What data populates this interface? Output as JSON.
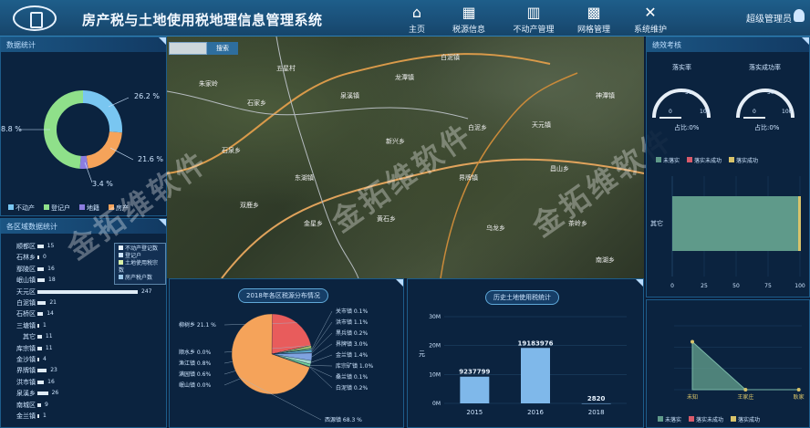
{
  "header": {
    "title": "房产税与土地使用税地理信息管理系统",
    "nav": [
      {
        "label": "主页",
        "icon": "home-icon"
      },
      {
        "label": "税源信息",
        "icon": "database-icon"
      },
      {
        "label": "不动产管理",
        "icon": "bar-chart-icon"
      },
      {
        "label": "网格管理",
        "icon": "map-icon"
      },
      {
        "label": "系统维护",
        "icon": "tools-icon"
      }
    ],
    "user": "超级管理员"
  },
  "data_stats": {
    "title": "数据统计",
    "pct_a": "26.2 %",
    "pct_b": "8.8 %",
    "pct_c": "21.6 %",
    "pct_d": "3.4 %",
    "legend": [
      "不动产",
      "登记户",
      "地籍",
      "房产"
    ]
  },
  "region_stats": {
    "title": "各区域数据统计",
    "legend": [
      "不动产登记数",
      "登记户",
      "土地使用税宗数",
      "房产税户数"
    ],
    "rows": [
      {
        "name": "顺都区",
        "v": "15"
      },
      {
        "name": "石林乡",
        "v": "0"
      },
      {
        "name": "鄢陵区",
        "v": "16"
      },
      {
        "name": "岷山镇",
        "v": "18"
      },
      {
        "name": "天元区",
        "v": "247"
      },
      {
        "name": "白泥镇",
        "v": "21"
      },
      {
        "name": "石桥区",
        "v": "14"
      },
      {
        "name": "三塘镇",
        "v": "1"
      },
      {
        "name": "其它",
        "v": "11"
      },
      {
        "name": "库宗镇",
        "v": "11"
      },
      {
        "name": "金沙镇",
        "v": "4"
      },
      {
        "name": "界牌镇",
        "v": "23"
      },
      {
        "name": "洪市镇",
        "v": "16"
      },
      {
        "name": "泉溪乡",
        "v": "26"
      },
      {
        "name": "南城区",
        "v": "9"
      },
      {
        "name": "金兰镇",
        "v": "1"
      }
    ]
  },
  "map": {
    "search_placeholder": "",
    "search_button": "搜索",
    "labels": [
      "朱家岭",
      "石家乡",
      "五星村",
      "泉溪镇",
      "龙潭镇",
      "白泥镇",
      "白泥乡",
      "天元镇",
      "昌山乡",
      "界牌镇",
      "新兴乡",
      "石泉乡",
      "双鹿乡",
      "金星乡",
      "黄石乡",
      "乌龙乡",
      "茶岭乡",
      "神潭镇",
      "东湖镇",
      "南湖乡"
    ]
  },
  "watermark": "金拓维软件",
  "perf": {
    "title": "绩效考核",
    "gauge1_title": "落实率",
    "gauge2_title": "落实成功率",
    "gauge1_label": "占比:0%",
    "gauge2_label": "占比:0%",
    "gauge_min": "0",
    "gauge_mid": "50",
    "gauge_max": "100",
    "legend": [
      "未落实",
      "落实未成功",
      "落实成功"
    ],
    "bar_category": "其它",
    "x_ticks": [
      "0",
      "25",
      "50",
      "75",
      "100"
    ],
    "bottom_legend": [
      "未落实",
      "落实未成功",
      "落实成功"
    ],
    "area_x": [
      "未知",
      "王家庄",
      "耿家"
    ]
  },
  "pie_panel": {
    "title": "2018年各区税源分布情况"
  },
  "chart_data": [
    {
      "type": "pie",
      "title": "数据统计",
      "note": "donut",
      "labels": [
        "不动产",
        "登记户",
        "地籍",
        "房产"
      ],
      "values": [
        26.2,
        8.8,
        21.6,
        3.4
      ]
    },
    {
      "type": "pie",
      "title": "2018年各区税源分布情况",
      "labels": [
        "柳树乡",
        "顺水乡",
        "渔江镇",
        "满园镇",
        "岷山镇",
        "关市镇",
        "洪市镇",
        "黑兵镇",
        "界牌镇",
        "金兰镇",
        "库宗矿镇",
        "桑兰镇",
        "白泥镇",
        "西源镇"
      ],
      "label_text": [
        "柳树乡 21.1 %",
        "顺水乡 0.0%",
        "渔江镇 0.8%",
        "满园镇 0.6%",
        "岷山镇 0.0%",
        "关市镇 0.1%",
        "洪市镇 1.1%",
        "黑兵镇 0.2%",
        "界牌镇 3.0%",
        "金兰镇 1.4%",
        "库宗矿镇 1.0%",
        "桑兰镇 0.1%",
        "白泥镇 0.2%",
        "西源镇 68.3 %"
      ],
      "values": [
        21.1,
        0.0,
        0.8,
        0.6,
        0.0,
        0.1,
        1.1,
        0.2,
        3.0,
        1.4,
        1.0,
        0.1,
        0.2,
        68.3
      ],
      "colors": [
        "#e85c5c",
        "#5a9fd6",
        "#c7d24a",
        "#7ad27a",
        "#9b7bd1",
        "#d6a16a",
        "#5aa9c9",
        "#f2b3c8",
        "#7fa3e0",
        "#a0d6c9",
        "#6fcf97",
        "#c98bd6",
        "#f4d06f",
        "#f5a35a"
      ]
    },
    {
      "type": "bar",
      "title": "历史土地使用税统计",
      "ylabel": "元",
      "categories": [
        "2015",
        "2016",
        "2018"
      ],
      "values": [
        9237799,
        19183976,
        2820
      ],
      "value_labels": [
        "9237799",
        "19183976",
        "2820"
      ],
      "y_ticks": [
        "0M",
        "10M",
        "20M",
        "30M"
      ],
      "ylim": [
        0,
        30000000
      ]
    },
    {
      "type": "bar",
      "title": "绩效考核",
      "categories": [
        "其它"
      ],
      "series": [
        {
          "name": "未落实",
          "values": [
            100
          ]
        },
        {
          "name": "落实未成功",
          "values": [
            0
          ]
        },
        {
          "name": "落实成功",
          "values": [
            0
          ]
        }
      ],
      "xlim": [
        0,
        100
      ]
    },
    {
      "type": "area",
      "categories": [
        "未知",
        "王家庄",
        "耿家"
      ],
      "values": [
        2,
        0,
        0
      ]
    }
  ]
}
